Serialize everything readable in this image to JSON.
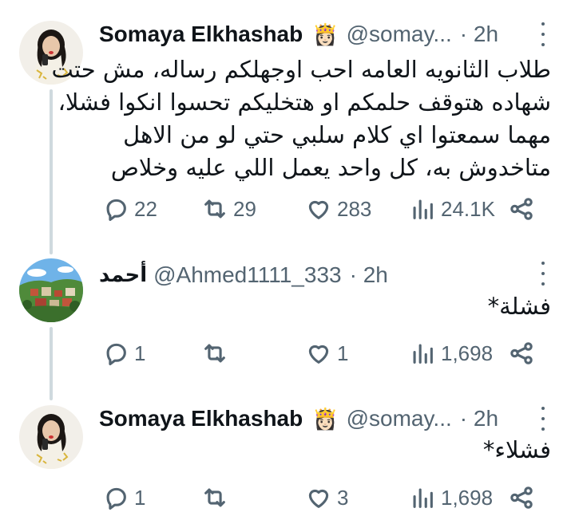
{
  "tweets": [
    {
      "name": "Somaya Elkhashab",
      "badge": "👸🏻",
      "handle": "@somay...",
      "time": "· 2h",
      "lines": [
        "طلاب الثانويه العامه احب اوجهلكم رساله، مش حتت",
        "شهاده هتوقف حلمكم او هتخليكم تحسوا انكوا فشلا،",
        "مهما سمعتوا اي كلام سلبي حتي لو من الاهل",
        "متاخدوش به، كل واحد يعمل اللي عليه وخلاص"
      ],
      "replies": "22",
      "retweets": "29",
      "likes": "283",
      "views": "24.1K"
    },
    {
      "name": "أحمد",
      "handle": "@Ahmed1111_333",
      "time": "· 2h",
      "lines": [
        "فشلة*"
      ],
      "replies": "1",
      "retweets": "",
      "likes": "1",
      "views": "1,698"
    },
    {
      "name": "Somaya Elkhashab",
      "badge": "👸🏻",
      "handle": "@somay...",
      "time": "· 2h",
      "lines": [
        "فشلاء*"
      ],
      "replies": "1",
      "retweets": "",
      "likes": "3",
      "views": "1,698"
    }
  ],
  "icons": [
    "reply-icon",
    "retweet-icon",
    "like-icon",
    "views-icon",
    "share-icon",
    "more-icon"
  ],
  "colors": {
    "text": "#0f1419",
    "muted": "#536471",
    "thread_line": "#cfd9de"
  }
}
